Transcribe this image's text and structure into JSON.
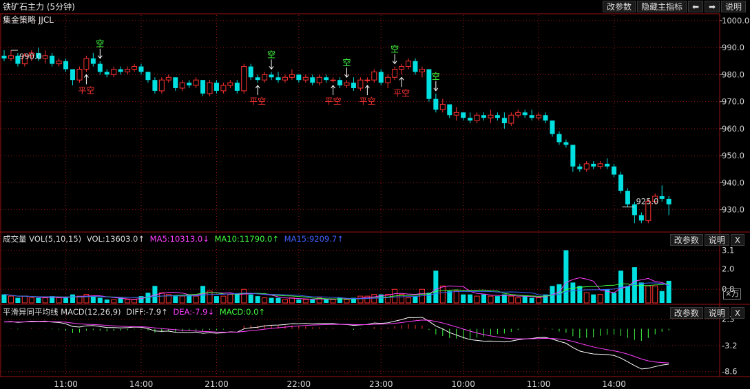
{
  "header": {
    "title": "铁矿石主力 (5分钟)",
    "subtitle": "集金策略 JJCL",
    "buttons": [
      "改参数",
      "隐藏主指标"
    ],
    "nav_prev": "⬅",
    "nav_next": "➡",
    "help": "说明"
  },
  "volume_pane": {
    "name": "成交量",
    "indicator": "VOL(5,10,15)",
    "vol": "VOL:13603.0↑",
    "ma5": "MA5:10313.0↓",
    "ma10": "MA10:11790.0↑",
    "ma15": "MA15:9209.7↑",
    "btn_params": "改参数",
    "btn_help": "说明",
    "btn_close": "X",
    "unit": "×万"
  },
  "macd_pane": {
    "name": "平滑异同平均线",
    "indicator": "MACD(12,26,9)",
    "diff": "DIFF:-7.9↑",
    "dea": "DEA:-7.9↓",
    "macd": "MACD:0.0↑",
    "btn_params": "改参数",
    "btn_help": "说明",
    "btn_close": "X"
  },
  "colors": {
    "up": "#ff3232",
    "down": "#00e0e0",
    "ma5": "#ff40ff",
    "ma10": "#40ff40",
    "ma15": "#4060ff",
    "diff": "#ffffff",
    "dea": "#ff40ff",
    "grid": "#9b1515",
    "signal_green": "#40ff40",
    "signal_red": "#ff3232"
  },
  "chart_data": {
    "type": "candlestick",
    "price_ylim": [
      922,
      1002
    ],
    "price_ticks": [
      "1000.0",
      "990.0",
      "980.0",
      "970.0",
      "960.0",
      "950.0",
      "940.0",
      "930.0"
    ],
    "x_ticks": [
      {
        "label": "11:00",
        "index": 9
      },
      {
        "label": "14:00",
        "index": 20
      },
      {
        "label": "21:00",
        "index": 31
      },
      {
        "label": "22:00",
        "index": 43
      },
      {
        "label": "23:00",
        "index": 55
      },
      {
        "label": "10:00",
        "index": 67
      },
      {
        "label": "11:00",
        "index": 78
      },
      {
        "label": "14:00",
        "index": 89
      }
    ],
    "high_label": {
      "text": "990.0",
      "index": 1
    },
    "low_label": {
      "text": "925.0",
      "index": 91
    },
    "candles": [
      [
        987,
        989,
        985,
        986
      ],
      [
        986,
        989,
        985,
        987
      ],
      [
        987,
        988,
        983,
        984
      ],
      [
        984,
        988,
        983,
        987
      ],
      [
        987,
        989,
        985,
        988
      ],
      [
        988,
        990,
        985,
        986
      ],
      [
        986,
        989,
        984,
        987
      ],
      [
        987,
        988,
        983,
        984
      ],
      [
        984,
        986,
        983,
        985
      ],
      [
        985,
        986,
        981,
        982
      ],
      [
        982,
        982,
        976,
        978
      ],
      [
        978,
        983,
        977,
        982
      ],
      [
        982,
        987,
        981,
        986
      ],
      [
        986,
        988,
        983,
        984
      ],
      [
        984,
        985,
        980,
        981
      ],
      [
        981,
        982,
        979,
        980
      ],
      [
        980,
        983,
        979,
        982
      ],
      [
        982,
        983,
        980,
        981
      ],
      [
        981,
        983,
        980,
        982
      ],
      [
        982,
        984,
        981,
        983
      ],
      [
        983,
        984,
        980,
        981
      ],
      [
        981,
        981,
        977,
        978
      ],
      [
        978,
        979,
        973,
        974
      ],
      [
        974,
        979,
        973,
        978
      ],
      [
        978,
        980,
        977,
        979
      ],
      [
        979,
        979,
        974,
        975
      ],
      [
        975,
        978,
        974,
        977
      ],
      [
        977,
        978,
        975,
        976
      ],
      [
        976,
        979,
        975,
        978
      ],
      [
        978,
        978,
        972,
        973
      ],
      [
        973,
        978,
        972,
        977
      ],
      [
        977,
        978,
        973,
        974
      ],
      [
        974,
        977,
        973,
        976
      ],
      [
        976,
        978,
        975,
        977
      ],
      [
        977,
        978,
        973,
        974
      ],
      [
        974,
        984,
        973,
        983
      ],
      [
        983,
        984,
        978,
        979
      ],
      [
        979,
        980,
        977,
        978
      ],
      [
        978,
        981,
        977,
        980
      ],
      [
        980,
        981,
        978,
        979
      ],
      [
        979,
        981,
        977,
        978
      ],
      [
        978,
        980,
        977,
        979
      ],
      [
        979,
        982,
        978,
        980
      ],
      [
        980,
        980,
        977,
        978
      ],
      [
        978,
        980,
        977,
        979
      ],
      [
        979,
        980,
        976,
        977
      ],
      [
        977,
        980,
        976,
        979
      ],
      [
        979,
        980,
        977,
        978
      ],
      [
        978,
        979,
        977,
        978
      ],
      [
        978,
        979,
        975,
        976
      ],
      [
        976,
        978,
        975,
        977
      ],
      [
        977,
        979,
        974,
        975
      ],
      [
        975,
        979,
        974,
        978
      ],
      [
        978,
        979,
        977,
        978
      ],
      [
        978,
        982,
        977,
        981
      ],
      [
        981,
        982,
        976,
        977
      ],
      [
        977,
        980,
        975,
        979
      ],
      [
        979,
        983,
        978,
        982
      ],
      [
        982,
        984,
        980,
        983
      ],
      [
        983,
        986,
        982,
        985
      ],
      [
        985,
        986,
        980,
        981
      ],
      [
        981,
        983,
        979,
        982
      ],
      [
        982,
        982,
        970,
        971
      ],
      [
        971,
        973,
        966,
        967
      ],
      [
        967,
        971,
        966,
        969
      ],
      [
        969,
        969,
        964,
        965
      ],
      [
        965,
        968,
        963,
        966
      ],
      [
        966,
        966,
        963,
        964
      ],
      [
        964,
        966,
        962,
        963
      ],
      [
        963,
        966,
        962,
        965
      ],
      [
        965,
        966,
        963,
        964
      ],
      [
        964,
        967,
        962,
        965
      ],
      [
        965,
        966,
        963,
        964
      ],
      [
        964,
        966,
        960,
        962
      ],
      [
        962,
        966,
        961,
        965
      ],
      [
        965,
        967,
        964,
        966
      ],
      [
        966,
        967,
        964,
        965
      ],
      [
        965,
        967,
        963,
        964
      ],
      [
        964,
        966,
        963,
        965
      ],
      [
        965,
        966,
        962,
        963
      ],
      [
        963,
        963,
        957,
        958
      ],
      [
        958,
        959,
        954,
        955
      ],
      [
        955,
        956,
        953,
        954
      ],
      [
        954,
        954,
        944,
        946
      ],
      [
        946,
        947,
        944,
        945
      ],
      [
        945,
        948,
        944,
        947
      ],
      [
        947,
        948,
        945,
        946
      ],
      [
        946,
        948,
        945,
        947
      ],
      [
        947,
        949,
        945,
        946
      ],
      [
        946,
        947,
        942,
        943
      ],
      [
        943,
        944,
        936,
        937
      ],
      [
        937,
        938,
        931,
        932
      ],
      [
        932,
        933,
        925,
        928
      ],
      [
        928,
        929,
        925,
        926
      ],
      [
        926,
        934,
        925,
        933
      ],
      [
        933,
        936,
        932,
        935
      ],
      [
        935,
        939,
        933,
        934
      ],
      [
        934,
        935,
        928,
        932
      ]
    ],
    "signals": [
      {
        "index": 12,
        "text": "平空",
        "position": "below"
      },
      {
        "index": 14,
        "text": "空",
        "position": "above"
      },
      {
        "index": 37,
        "text": "平空",
        "position": "below"
      },
      {
        "index": 39,
        "text": "空",
        "position": "above"
      },
      {
        "index": 48,
        "text": "平空",
        "position": "below"
      },
      {
        "index": 50,
        "text": "空",
        "position": "above"
      },
      {
        "index": 53,
        "text": "平空",
        "position": "below"
      },
      {
        "index": 57,
        "text": "空",
        "position": "above"
      },
      {
        "index": 58,
        "text": "平空",
        "position": "below"
      },
      {
        "index": 63,
        "text": "空",
        "position": "above"
      }
    ],
    "volume_ylim": [
      0,
      3.4
    ],
    "volume_ticks": [
      "3.1",
      "2.0",
      "0.8"
    ],
    "volumes": [
      0.5,
      0.4,
      0.3,
      0.4,
      0.3,
      0.3,
      0.3,
      0.4,
      0.3,
      0.3,
      0.5,
      0.4,
      0.5,
      0.4,
      0.3,
      0.2,
      0.2,
      0.3,
      0.2,
      0.2,
      0.4,
      0.6,
      1.0,
      0.6,
      0.5,
      0.4,
      0.4,
      0.5,
      0.4,
      1.0,
      0.7,
      0.4,
      0.4,
      0.5,
      0.5,
      0.8,
      0.5,
      0.4,
      0.3,
      0.3,
      0.3,
      0.2,
      0.3,
      0.2,
      0.2,
      0.2,
      0.3,
      0.2,
      0.2,
      0.3,
      0.2,
      0.3,
      0.4,
      0.4,
      0.5,
      0.5,
      0.5,
      0.8,
      0.5,
      0.3,
      0.4,
      0.8,
      0.6,
      1.9,
      1.0,
      0.7,
      0.7,
      0.5,
      0.5,
      0.4,
      0.5,
      0.4,
      0.4,
      0.5,
      0.4,
      0.3,
      0.4,
      0.3,
      0.3,
      0.5,
      1.0,
      1.1,
      3.1,
      1.2,
      1.0,
      0.6,
      0.5,
      0.5,
      0.8,
      0.6,
      1.9,
      1.0,
      2.1,
      1.2,
      1.0,
      1.0,
      0.7,
      1.3
    ],
    "macd_ylim": [
      -9.5,
      2.8
    ],
    "macd_ticks": [
      "2.3",
      "-3.2",
      "-8.6"
    ]
  }
}
